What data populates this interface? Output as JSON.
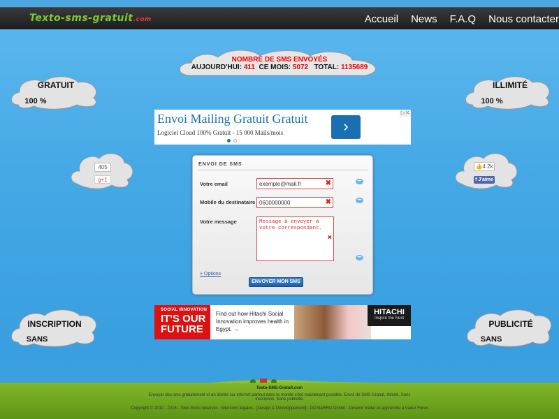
{
  "header": {
    "logo": "Texto-sms-gratuit",
    "logo_domain": ".com",
    "nav": [
      "Accueil",
      "News",
      "F.A.Q",
      "Nous contacter"
    ]
  },
  "stats": {
    "title": "NOMBRE DE SMS ENVOYÉS",
    "today_label": "AUJOURD'HUI:",
    "today_value": "411",
    "month_label": "CE MOIS:",
    "month_value": "5072",
    "total_label": "TOTAL:",
    "total_value": "1135689"
  },
  "clouds": {
    "gratuit_title": "GRATUIT",
    "gratuit_value": "100 %",
    "illimite_title": "ILLIMITÉ",
    "illimite_value": "100 %",
    "inscription_title": "INSCRIPTION",
    "inscription_value": "SANS",
    "publicite_title": "PUBLICITÉ",
    "publicite_value": "SANS"
  },
  "ad": {
    "title": "Envoi Mailing Gratuit Gratuit",
    "subtitle": "Logiciel Cloud 100% Gratuit - 15 000 Mails/mois",
    "arrow": "›"
  },
  "social": {
    "gplus_count": "405",
    "gplus_label": "g+1",
    "fb_count": "4.2k",
    "fb_label": "J'aime"
  },
  "form": {
    "heading": "ENVOI DE SMS",
    "email_label": "Votre email",
    "email_value": "exemple@mail.fr",
    "mobile_label": "Mobile du destinataire",
    "mobile_value": "0600000000",
    "message_label": "Votre message",
    "message_value": "Message à envoyer à votre correspondant.",
    "options_link": "+ Options",
    "submit": "ENVOYER MON SMS"
  },
  "banner": {
    "tag": "SOCIAL INNOVATION",
    "headline": "IT'S OUR FUTURE",
    "text": "Find out how Hitachi Social Innovation improves health in Egypt. →",
    "brand": "HITACHI",
    "brand_sub": "Inspire the Next"
  },
  "footer": {
    "site": "Texto-SMS-Gratuit.com",
    "desc": "Envoyer des sms gratuitement et en illimité sur internet partout dans le monde c'est maintenant possible. Envoi de SMS Gratuit, Illimité, Sans inscription, Sans publicité.",
    "copyright": "Copyright © 2010 - 2015 - Tous droits réservés : Mentions légales - [Design & Développement] : DO BARRO Dimitri - Devenir trader et apprendre à trader Forex"
  }
}
